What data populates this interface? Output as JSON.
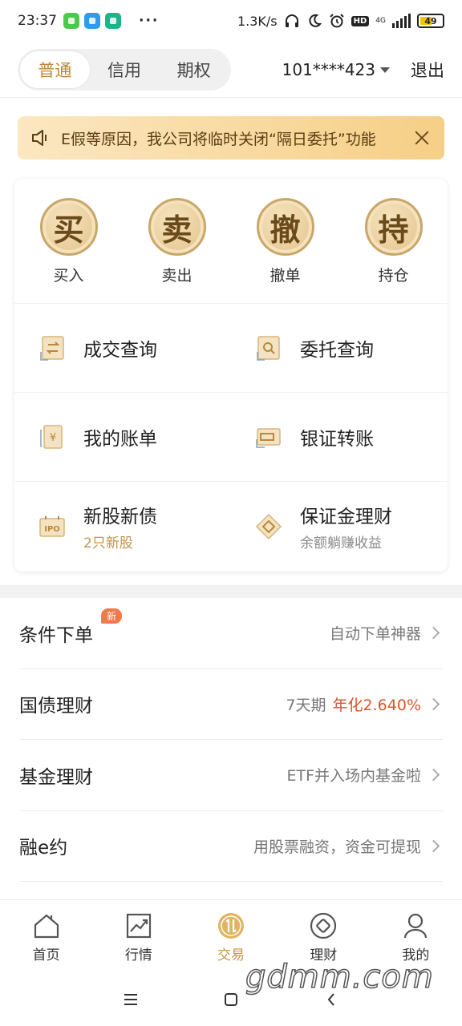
{
  "status_bar": {
    "time": "23:37",
    "dots": "···",
    "speed": "1.3K/s",
    "hd": "HD",
    "network": "4G",
    "battery": "49"
  },
  "header": {
    "tabs": [
      {
        "label": "普通",
        "active": true
      },
      {
        "label": "信用",
        "active": false
      },
      {
        "label": "期权",
        "active": false
      }
    ],
    "account": "101****423",
    "logout": "退出"
  },
  "notice": {
    "text": "E假等原因，我公司将临时关闭“隔日委托”功能"
  },
  "quick_actions": [
    {
      "glyph": "买",
      "label": "买入"
    },
    {
      "glyph": "卖",
      "label": "卖出"
    },
    {
      "glyph": "撤",
      "label": "撤单"
    },
    {
      "glyph": "持",
      "label": "持仓"
    }
  ],
  "grid": {
    "deals": {
      "title": "成交查询"
    },
    "orders": {
      "title": "委托查询"
    },
    "bill": {
      "title": "我的账单"
    },
    "transfer": {
      "title": "银证转账"
    },
    "ipo": {
      "title": "新股新债",
      "sub": "2只新股"
    },
    "margin": {
      "title": "保证金理财",
      "sub": "余额躺赚收益"
    }
  },
  "list": [
    {
      "title": "条件下单",
      "badge": "新",
      "right": "自动下单神器"
    },
    {
      "title": "国债理财",
      "right": "7天期",
      "highlight": "年化2.640%"
    },
    {
      "title": "基金理财",
      "right": "ETF并入场内基金啦"
    },
    {
      "title": "融e约",
      "right": "用股票融资，资金可提现"
    }
  ],
  "bottom_nav": [
    {
      "label": "首页",
      "active": false
    },
    {
      "label": "行情",
      "active": false
    },
    {
      "label": "交易",
      "active": true
    },
    {
      "label": "理财",
      "active": false
    },
    {
      "label": "我的",
      "active": false
    }
  ],
  "watermark": "gdmm.com",
  "colors": {
    "gold": "#c39545",
    "highlight": "#d9572c",
    "badge": "#f07a4a"
  }
}
